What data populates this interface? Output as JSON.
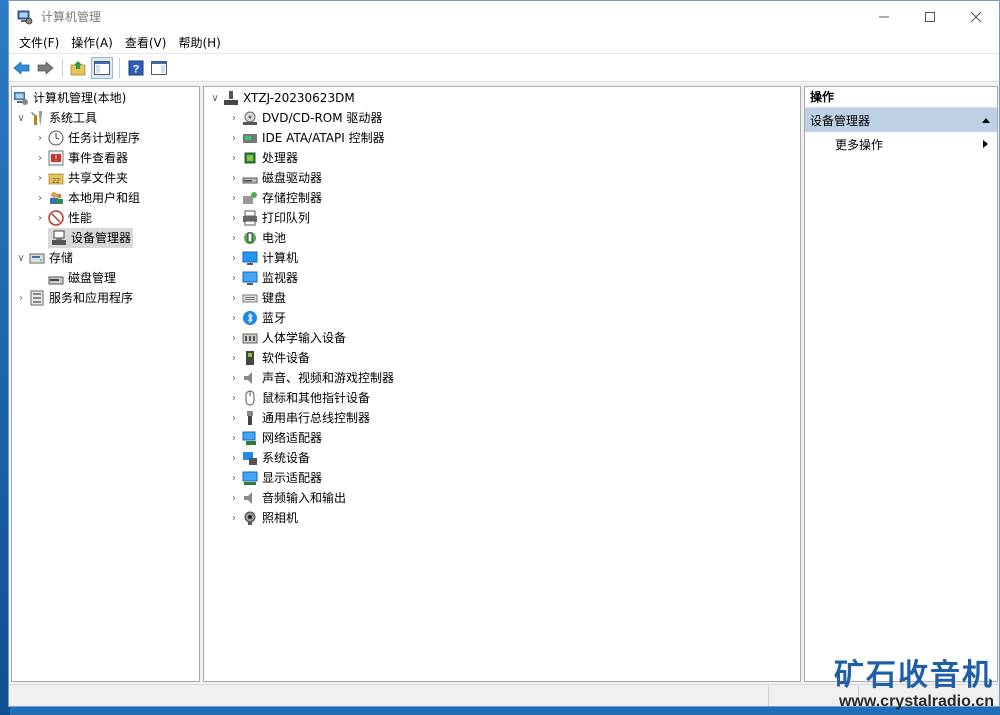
{
  "window": {
    "title": "计算机管理"
  },
  "menu": [
    "文件(F)",
    "操作(A)",
    "查看(V)",
    "帮助(H)"
  ],
  "tree": {
    "root": "计算机管理(本地)",
    "system_tools": "系统工具",
    "system_tools_children": [
      "任务计划程序",
      "事件查看器",
      "共享文件夹",
      "本地用户和组",
      "性能",
      "设备管理器"
    ],
    "storage": "存储",
    "storage_children": [
      "磁盘管理"
    ],
    "services": "服务和应用程序"
  },
  "devices": {
    "computer_name": "XTZJ-20230623DM",
    "categories": [
      "DVD/CD-ROM 驱动器",
      "IDE ATA/ATAPI 控制器",
      "处理器",
      "磁盘驱动器",
      "存储控制器",
      "打印队列",
      "电池",
      "计算机",
      "监视器",
      "键盘",
      "蓝牙",
      "人体学输入设备",
      "软件设备",
      "声音、视频和游戏控制器",
      "鼠标和其他指针设备",
      "通用串行总线控制器",
      "网络适配器",
      "系统设备",
      "显示适配器",
      "音频输入和输出",
      "照相机"
    ]
  },
  "actions": {
    "header": "操作",
    "section": "设备管理器",
    "more": "更多操作"
  },
  "watermark": {
    "brand": "矿石收音机",
    "url": "www.crystalradio.cn"
  }
}
